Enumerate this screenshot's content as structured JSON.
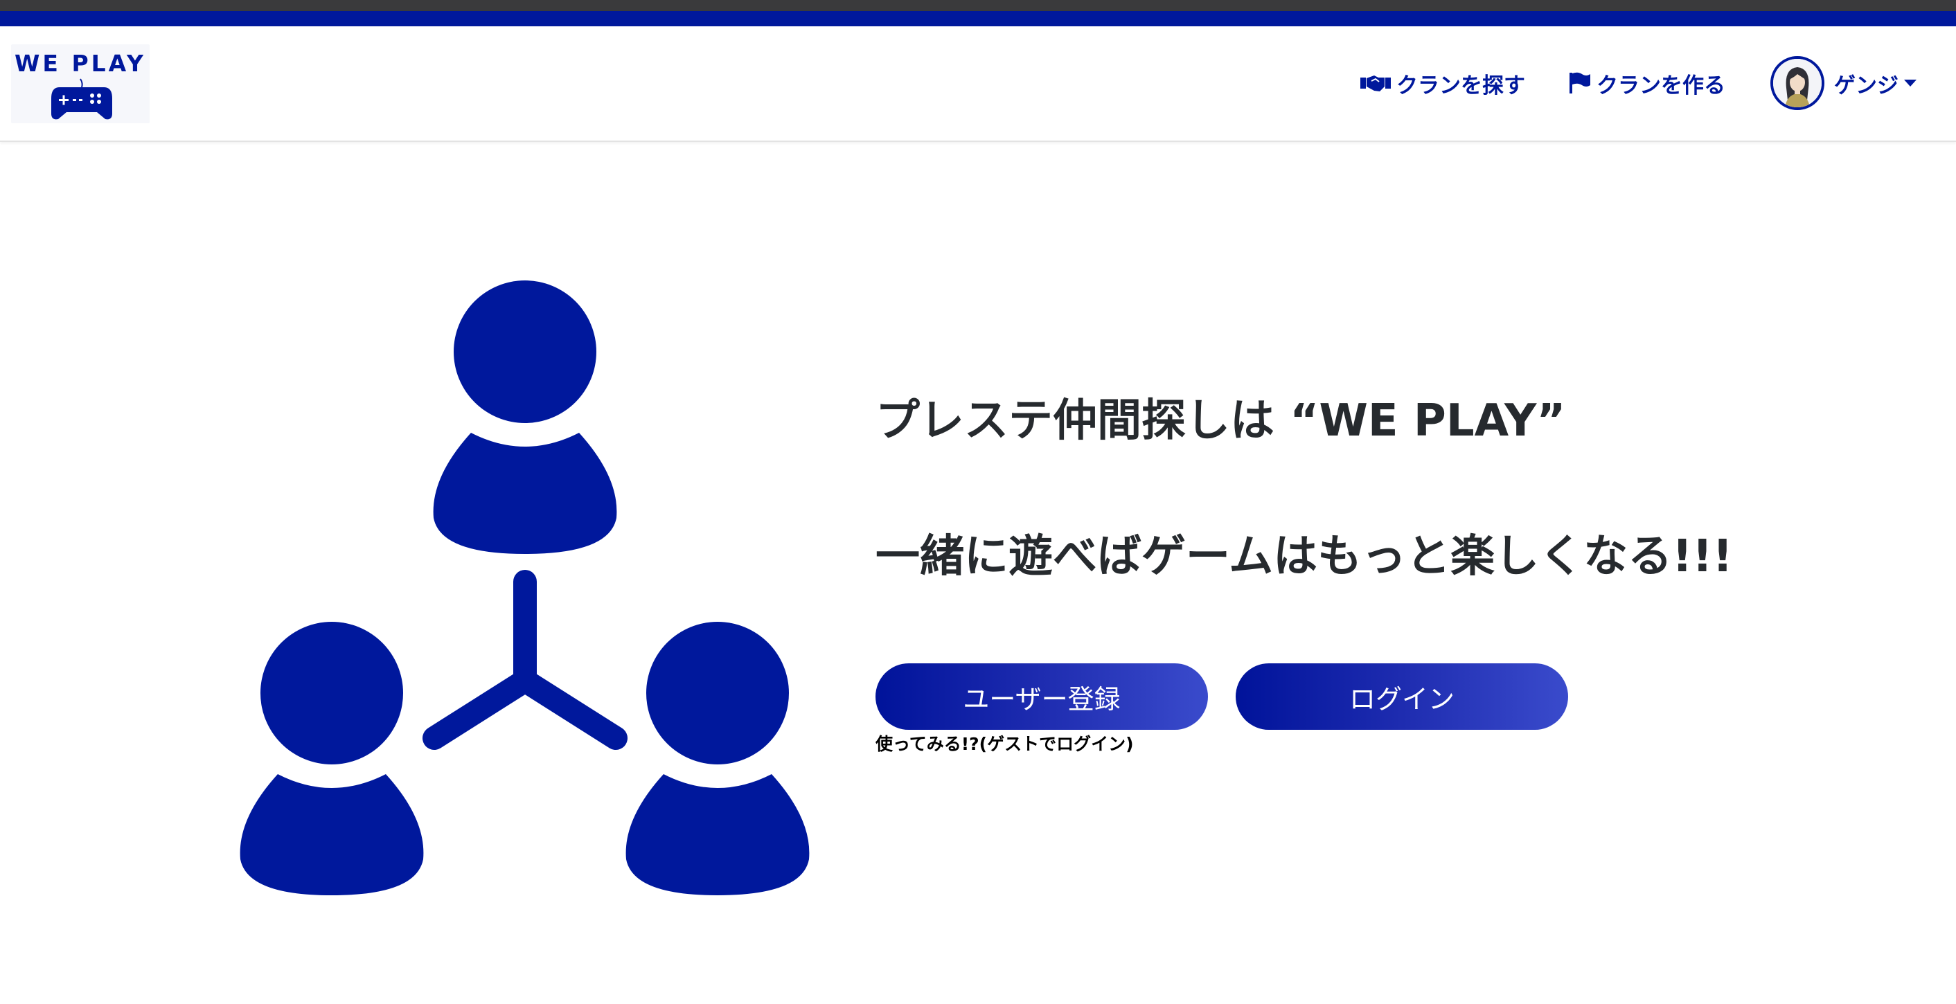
{
  "brand": {
    "logo_text": "WE PLAY",
    "color": "#00189c"
  },
  "nav": {
    "find_clan": {
      "label": "クランを探す",
      "icon": "handshake-icon"
    },
    "create_clan": {
      "label": "クランを作る",
      "icon": "flag-icon"
    },
    "user": {
      "name": "ゲンジ",
      "avatar": "user-avatar"
    }
  },
  "hero": {
    "headline_1": "プレステ仲間探しは “WE PLAY”",
    "headline_2": "一緒に遊べばゲームはもっと楽しくなる!!!",
    "illustration": "people-network-icon"
  },
  "actions": {
    "register_label": "ユーザー登録",
    "login_label": "ログイン",
    "guest_login": "使ってみる!?(ゲストでログイン)"
  }
}
